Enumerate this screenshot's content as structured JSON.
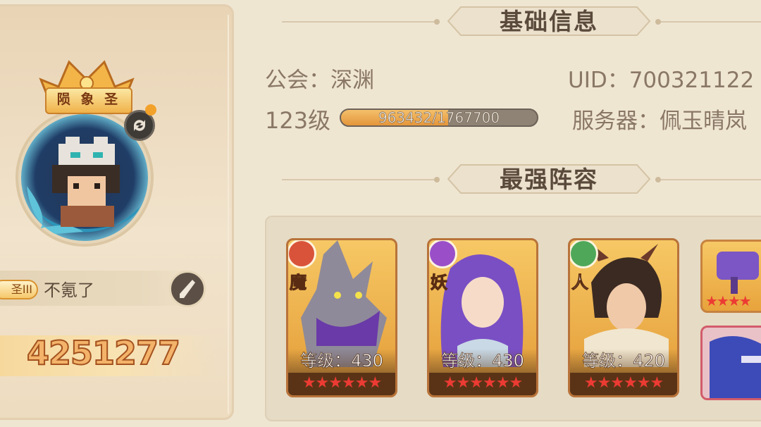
{
  "player": {
    "title_plate": "陨 象 圣",
    "rank_badge": "圣III",
    "name": "不氪了",
    "power": "4251277"
  },
  "basic_info": {
    "header": "基础信息",
    "guild_label": "公会：深渊",
    "uid_label": "UID：700321122",
    "level_label": "123级",
    "exp_text": "963432/1767700",
    "exp_fraction": 0.545,
    "server_label": "服务器：佩玉晴岚"
  },
  "lineup": {
    "header": "最强阵容",
    "heroes": [
      {
        "faction": "魔",
        "faction_color": "#d9533a",
        "level": "等级：430",
        "stars": "★★★★★★"
      },
      {
        "faction": "妖",
        "faction_color": "#9a4fc9",
        "level": "等级：430",
        "stars": "★★★★★★"
      },
      {
        "faction": "人",
        "faction_color": "#4fa85a",
        "level": "等级：420",
        "stars": "★★★★★★"
      }
    ],
    "side_stars": "★★★★"
  },
  "icons": [
    "crown-icon",
    "swap-icon",
    "edit-icon",
    "faction-demon-icon",
    "faction-yao-icon",
    "faction-human-icon"
  ]
}
